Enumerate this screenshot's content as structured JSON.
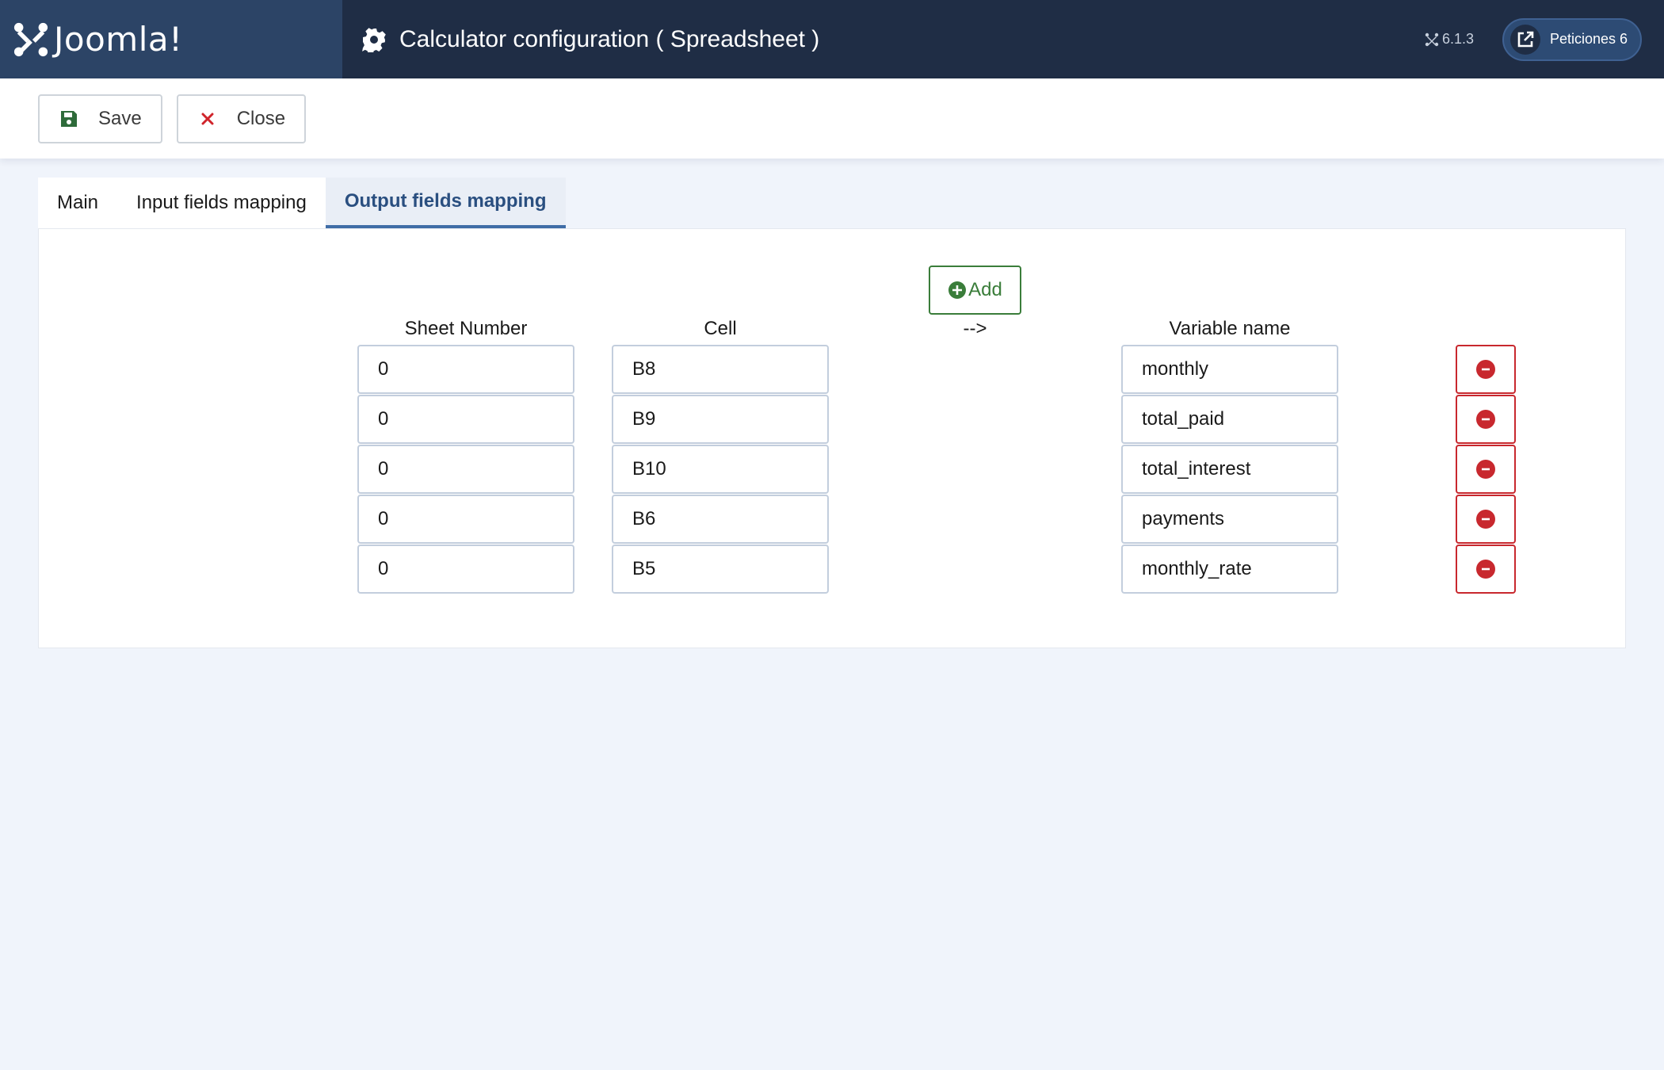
{
  "header": {
    "brand": "Joomla!",
    "page_title": "Calculator configuration ( Spreadsheet )",
    "version": "6.1.3",
    "peticiones_label": "Peticiones 6"
  },
  "toolbar": {
    "save_label": "Save",
    "close_label": "Close"
  },
  "tabs": [
    {
      "label": "Main",
      "active": false
    },
    {
      "label": "Input fields mapping",
      "active": false
    },
    {
      "label": "Output fields mapping",
      "active": true
    }
  ],
  "mapping": {
    "add_label": "Add",
    "headers": {
      "sheet": "Sheet Number",
      "cell": "Cell",
      "arrow": "-->",
      "variable": "Variable name"
    },
    "rows": [
      {
        "sheet": "0",
        "cell": "B8",
        "variable": "monthly"
      },
      {
        "sheet": "0",
        "cell": "B9",
        "variable": "total_paid"
      },
      {
        "sheet": "0",
        "cell": "B10",
        "variable": "total_interest"
      },
      {
        "sheet": "0",
        "cell": "B6",
        "variable": "payments"
      },
      {
        "sheet": "0",
        "cell": "B5",
        "variable": "monthly_rate"
      }
    ]
  },
  "icons": {
    "brand": "joomla-logo-icon",
    "title": "gear-icon",
    "version": "joomla-small-icon",
    "peticiones": "external-link-icon",
    "save": "floppy-disk-icon",
    "close": "x-icon",
    "add": "plus-circle-icon",
    "remove": "minus-circle-icon"
  },
  "colors": {
    "header_bg": "#1f2d45",
    "brand_bg": "#2c4466",
    "active_tab": "#2a4f80",
    "add_green": "#3a7d3a",
    "remove_red": "#c8282e",
    "close_red": "#d0242b",
    "save_green": "#2e6b3a"
  }
}
